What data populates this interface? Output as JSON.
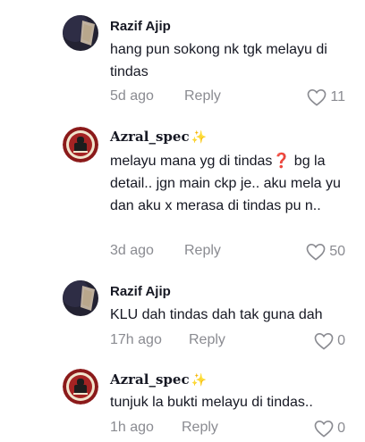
{
  "comments": [
    {
      "username": "Razif Ajip",
      "text": "hang pun sokong nk tgk melayu di tindas",
      "time": "5d ago",
      "reply": "Reply",
      "likes": "11",
      "avatar_icon": "dark-avatar-icon"
    },
    {
      "username": "Azral_spec",
      "sparkle": "✨",
      "text_parts": [
        "melayu mana yg di tindas",
        "❓",
        " bg la detail.. jgn main ckp je.. aku mela yu dan aku x merasa di tindas pu n.."
      ],
      "time": "3d ago",
      "reply": "Reply",
      "likes": "50",
      "avatar_icon": "emblem-avatar-icon"
    },
    {
      "username": "Razif Ajip",
      "text": "KLU dah tindas dah tak guna dah",
      "time": "17h ago",
      "reply": "Reply",
      "likes": "0",
      "avatar_icon": "dark-avatar-icon"
    },
    {
      "username": "Azral_spec",
      "sparkle": "✨",
      "text": "tunjuk la bukti melayu di tindas..",
      "time": "1h ago",
      "reply": "Reply",
      "likes": "0",
      "avatar_icon": "emblem-avatar-icon"
    }
  ],
  "colors": {
    "text": "#161823",
    "muted": "#8a8b91",
    "sparkle": "#f5b800",
    "question": "#e0245e",
    "emblem_red": "#8b1a1a"
  }
}
